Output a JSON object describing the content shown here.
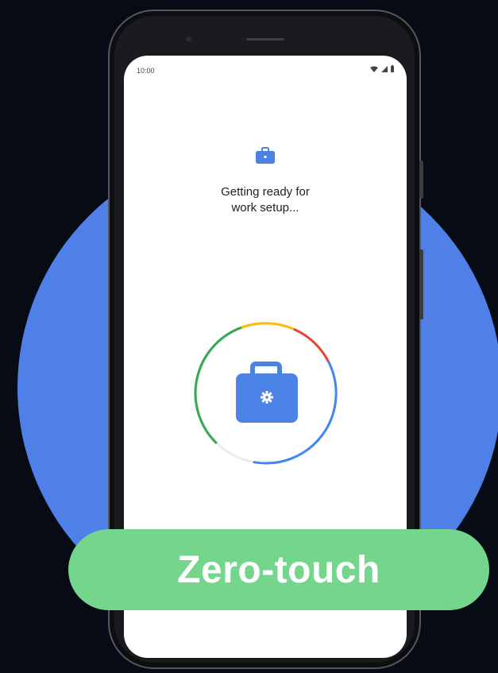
{
  "status_bar": {
    "time": "10:00"
  },
  "screen": {
    "title_line1": "Getting ready for",
    "title_line2": "work setup..."
  },
  "badge": {
    "label": "Zero-touch"
  },
  "colors": {
    "background": "#070b16",
    "circle": "#4f80e8",
    "badge": "#74d68d",
    "briefcase": "#4a82e6",
    "ring_green": "#34a853",
    "ring_yellow": "#fbbc04",
    "ring_red": "#ea4335",
    "ring_blue": "#4285f4"
  },
  "icons": [
    "briefcase-icon",
    "wifi-icon",
    "signal-icon",
    "battery-icon",
    "gear-icon"
  ]
}
